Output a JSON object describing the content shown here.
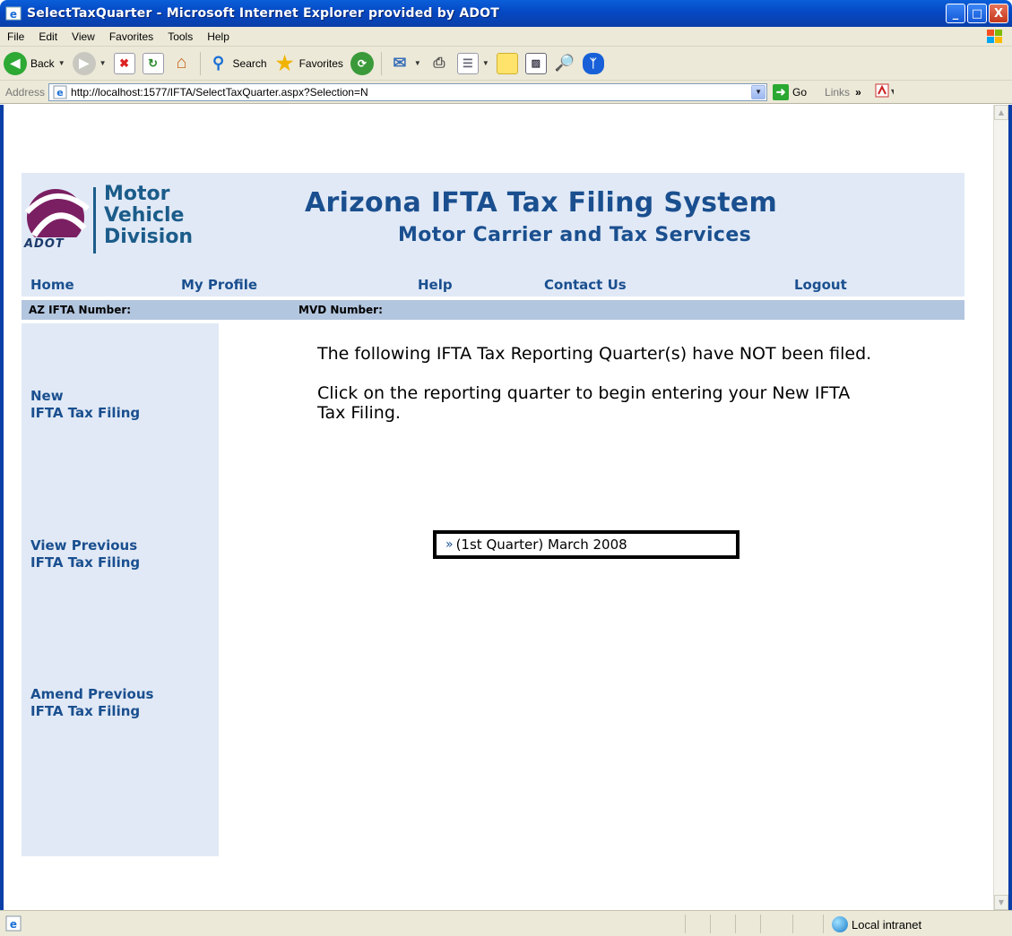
{
  "window": {
    "title": "SelectTaxQuarter - Microsoft Internet Explorer provided by ADOT",
    "controls": {
      "minimize": "_",
      "maximize": "□",
      "close": "X"
    }
  },
  "menu": [
    "File",
    "Edit",
    "View",
    "Favorites",
    "Tools",
    "Help"
  ],
  "toolbar": {
    "back_label": "Back",
    "search_label": "Search",
    "favorites_label": "Favorites"
  },
  "address": {
    "label": "Address",
    "url": "http://localhost:1577/IFTA/SelectTaxQuarter.aspx?Selection=N",
    "go_label": "Go",
    "links_label": "Links"
  },
  "header": {
    "logo_lines": [
      "Motor",
      "Vehicle",
      "Division"
    ],
    "logo_mark": "ADOT",
    "title": "Arizona IFTA Tax Filing System",
    "subtitle": "Motor Carrier and Tax Services"
  },
  "nav": {
    "home": "Home",
    "profile": "My Profile",
    "help": "Help",
    "contact": "Contact Us",
    "logout": "Logout"
  },
  "info": {
    "az_ifta_label": "AZ IFTA Number:",
    "mvd_label": "MVD Number:"
  },
  "sidebar": {
    "new_line1": "New",
    "new_line2": "IFTA Tax Filing",
    "view_line1": "View Previous",
    "view_line2": "IFTA Tax Filing",
    "amend_line1": "Amend Previous",
    "amend_line2": "IFTA Tax Filing"
  },
  "main": {
    "para1": "The following IFTA Tax Reporting Quarter(s) have NOT been filed.",
    "para2": "Click on the reporting quarter to begin entering your New IFTA Tax Filing.",
    "quarter_marker": "»",
    "quarter_label": "(1st Quarter) March 2008"
  },
  "status": {
    "zone": "Local intranet"
  },
  "colors": {
    "brand_blue": "#1a4f8f",
    "header_bg": "#e1e9f6",
    "info_bar": "#b3c6df",
    "titlebar": "#0548c4"
  }
}
